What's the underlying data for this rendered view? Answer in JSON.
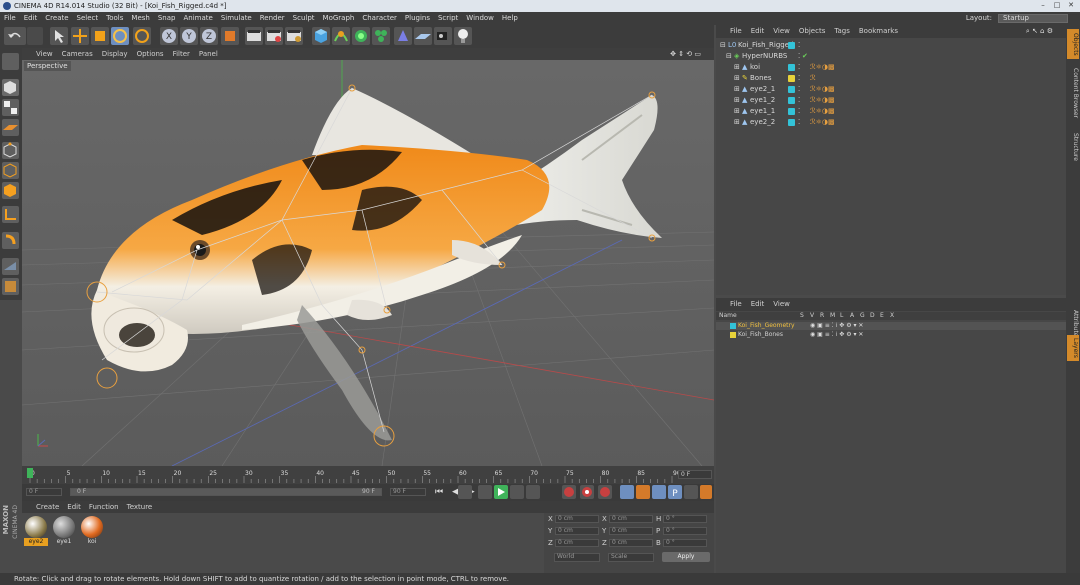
{
  "window": {
    "title": "CINEMA 4D R14.014 Studio (32 Bit) - [Koi_Fish_Rigged.c4d *]",
    "min": "–",
    "max": "□",
    "close": "✕"
  },
  "menu": [
    "File",
    "Edit",
    "Create",
    "Select",
    "Tools",
    "Mesh",
    "Snap",
    "Animate",
    "Simulate",
    "Render",
    "Sculpt",
    "MoGraph",
    "Character",
    "Plugins",
    "Script",
    "Window",
    "Help"
  ],
  "layout": {
    "label": "Layout:",
    "value": "Startup"
  },
  "viewport": {
    "menu": [
      "View",
      "Cameras",
      "Display",
      "Options",
      "Filter",
      "Panel"
    ],
    "camera": "Perspective"
  },
  "timeline": {
    "ticks": [
      "0",
      "5",
      "10",
      "15",
      "20",
      "25",
      "30",
      "35",
      "40",
      "45",
      "50",
      "55",
      "60",
      "65",
      "70",
      "75",
      "80",
      "85",
      "90"
    ],
    "current_frame": "0 F",
    "start": "0 F",
    "range_start": "0 F",
    "range_end": "90 F",
    "end": "90 F",
    "current": 0,
    "max": 90
  },
  "materials": {
    "menu": [
      "Create",
      "Edit",
      "Function",
      "Texture"
    ],
    "items": [
      {
        "label": "eye2",
        "selected": true
      },
      {
        "label": "eye1",
        "selected": false
      },
      {
        "label": "koi",
        "selected": false
      }
    ]
  },
  "brand": [
    "MAXON",
    "CINEMA 4D"
  ],
  "coords": {
    "rows": [
      [
        "X",
        "0 cm",
        "X",
        "0 cm",
        "H",
        "0 °"
      ],
      [
        "Y",
        "0 cm",
        "Y",
        "0 cm",
        "P",
        "0 °"
      ],
      [
        "Z",
        "0 cm",
        "Z",
        "0 cm",
        "B",
        "0 °"
      ]
    ],
    "mode1": "World",
    "mode2": "Scale",
    "apply": "Apply"
  },
  "objects": {
    "menu": [
      "File",
      "Edit",
      "View",
      "Objects",
      "Tags",
      "Bookmarks"
    ],
    "tree": [
      {
        "name": "Koi_Fish_Rigged",
        "indent": 0,
        "color": "#33c3d8"
      },
      {
        "name": "HyperNURBS",
        "indent": 1,
        "color": "#b8b8b8"
      },
      {
        "name": "koi",
        "indent": 2,
        "color": "#33c3d8"
      },
      {
        "name": "Bones",
        "indent": 2,
        "color": "#e8d23a"
      },
      {
        "name": "eye2_1",
        "indent": 2,
        "color": "#33c3d8"
      },
      {
        "name": "eye1_2",
        "indent": 2,
        "color": "#33c3d8"
      },
      {
        "name": "eye1_1",
        "indent": 2,
        "color": "#33c3d8"
      },
      {
        "name": "eye2_2",
        "indent": 2,
        "color": "#33c3d8"
      }
    ]
  },
  "layers": {
    "menu": [
      "File",
      "Edit",
      "View"
    ],
    "columns": [
      "Name",
      "S",
      "V",
      "R",
      "M",
      "L",
      "A",
      "G",
      "D",
      "E",
      "X"
    ],
    "rows": [
      {
        "name": "Koi_Fish_Geometry",
        "color": "#33c3d8",
        "selected": true
      },
      {
        "name": "Koi_Fish_Bones",
        "color": "#e8d23a",
        "selected": false
      }
    ]
  },
  "side_tabs": [
    "Objects",
    "Content Browser",
    "Structure",
    "Attributes",
    "Layers"
  ],
  "status": "Rotate: Click and drag to rotate elements. Hold down SHIFT to add to quantize rotation / add to the selection in point mode, CTRL to remove."
}
